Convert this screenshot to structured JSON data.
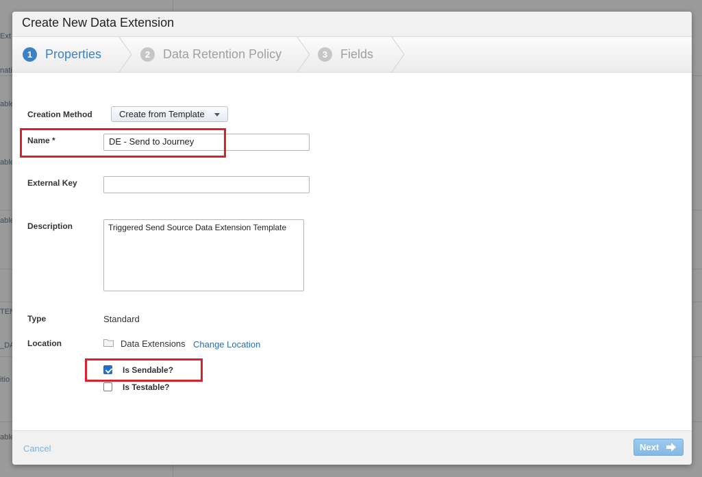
{
  "background": {
    "row_fragments": [
      "Ext",
      "nati",
      "able",
      "able",
      "able",
      "TEN",
      "_DA",
      "itio",
      "able"
    ]
  },
  "dialog": {
    "title": "Create New Data Extension"
  },
  "wizard": {
    "steps": [
      {
        "number": "1",
        "label": "Properties",
        "state": "active"
      },
      {
        "number": "2",
        "label": "Data Retention Policy",
        "state": "inactive"
      },
      {
        "number": "3",
        "label": "Fields",
        "state": "inactive"
      }
    ]
  },
  "form": {
    "creation_method": {
      "label": "Creation Method",
      "value": "Create from Template"
    },
    "name": {
      "label": "Name *",
      "value": "DE - Send to Journey"
    },
    "external_key": {
      "label": "External Key",
      "value": ""
    },
    "description": {
      "label": "Description",
      "value": "Triggered Send Source Data Extension Template"
    },
    "type": {
      "label": "Type",
      "value": "Standard"
    },
    "location": {
      "label": "Location",
      "value": "Data Extensions",
      "change_link": "Change Location"
    },
    "is_sendable": {
      "label": "Is Sendable?",
      "checked": true
    },
    "is_testable": {
      "label": "Is Testable?",
      "checked": false
    }
  },
  "footer": {
    "cancel_label": "Cancel",
    "next_label": "Next"
  },
  "colors": {
    "accent": "#3d80c5",
    "highlight": "#d9202c",
    "link": "#2a6ea8"
  },
  "icons": {
    "folder": "folder-icon",
    "dropdown": "caret-down-icon",
    "next": "arrow-right-icon"
  }
}
